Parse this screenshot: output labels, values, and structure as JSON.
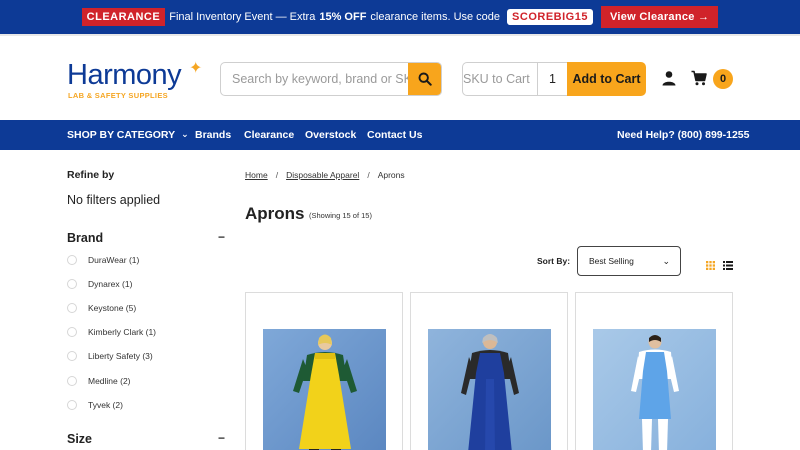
{
  "promo": {
    "badge": "CLEARANCE",
    "text_before": "Final Inventory Event — Extra",
    "discount": "15% OFF",
    "text_after": "clearance items. Use code",
    "code": "SCOREBIG15",
    "cta": "View Clearance →"
  },
  "brand": {
    "name": "Harmony",
    "tagline": "LAB & SAFETY SUPPLIES",
    "color_primary": "#0d3a96",
    "color_accent": "#f5a623"
  },
  "search": {
    "placeholder": "Search by keyword, brand or SKU",
    "icon": "search-icon"
  },
  "quick_add": {
    "sku_placeholder": "SKU to Cart",
    "qty_value": "1",
    "button": "Add to Cart"
  },
  "header_icons": {
    "account": "user-icon",
    "cart": "cart-icon",
    "cart_count": "0"
  },
  "nav": {
    "items": [
      "SHOP BY CATEGORY",
      "Brands",
      "Clearance",
      "Overstock",
      "Contact Us"
    ],
    "help": "Need Help? (800) 899-1255"
  },
  "sidebar": {
    "refine_label": "Refine by",
    "no_filters": "No filters applied",
    "brand_facet": {
      "title": "Brand",
      "toggle": "−",
      "options": [
        "DuraWear (1)",
        "Dynarex (1)",
        "Keystone (5)",
        "Kimberly Clark (1)",
        "Liberty Safety (3)",
        "Medline (2)",
        "Tyvek (2)"
      ]
    },
    "size_facet": {
      "title": "Size",
      "toggle": "−"
    }
  },
  "main": {
    "breadcrumb": [
      "Home",
      "Disposable Apparel",
      "Aprons"
    ],
    "breadcrumb_sep": "/",
    "title": "Aprons",
    "showing": "(Showing 15 of 15)",
    "sort_label": "Sort By:",
    "sort_value": "Best Selling",
    "view_icons": [
      "grid-icon",
      "list-icon"
    ],
    "products": [
      {
        "name": "yellow-apron-product-image"
      },
      {
        "name": "blue-apron-product-image"
      },
      {
        "name": "light-blue-apron-product-image"
      }
    ]
  }
}
